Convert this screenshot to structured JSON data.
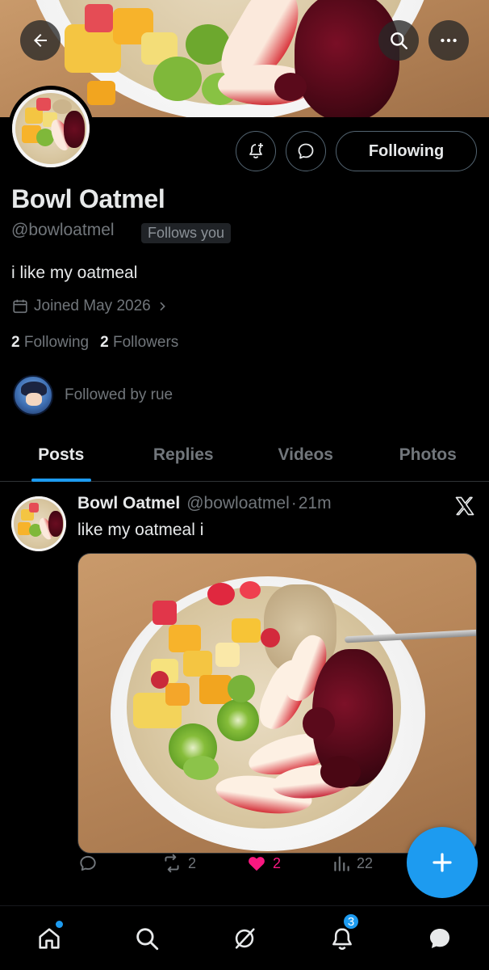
{
  "profile": {
    "name": "Bowl Oatmel",
    "handle": "@bowloatmel",
    "follows_you_badge": "Follows you",
    "bio": "i like my oatmeal",
    "joined": "Joined May 2026",
    "following_count": "2",
    "following_label": "Following",
    "followers_count": "2",
    "followers_label": "Followers",
    "followed_by": "Followed by rue",
    "follow_button_label": "Following"
  },
  "header": {
    "back_icon": "arrow-left-icon",
    "search_icon": "search-icon",
    "more_icon": "more-horizontal-icon"
  },
  "tabs": [
    {
      "label": "Posts",
      "active": true
    },
    {
      "label": "Replies",
      "active": false
    },
    {
      "label": "Videos",
      "active": false
    },
    {
      "label": "Photos",
      "active": false
    }
  ],
  "post": {
    "author_name": "Bowl Oatmel",
    "author_handle": "@bowloatmel",
    "separator": "·",
    "time": "21m",
    "text": "like my oatmeal i",
    "source_icon": "x-logo-icon",
    "reply_count": "",
    "repost_count": "2",
    "like_count": "2",
    "liked": true,
    "views_count": "22"
  },
  "bottom_nav": {
    "items": [
      "home-icon",
      "search-icon",
      "grok-icon",
      "notifications-icon",
      "messages-icon"
    ],
    "notifications_badge": "3"
  },
  "colors": {
    "background": "#000000",
    "accent": "#1d9bf0",
    "like": "#f91880",
    "muted_text": "#71767b",
    "primary_text": "#e7e9ea"
  }
}
